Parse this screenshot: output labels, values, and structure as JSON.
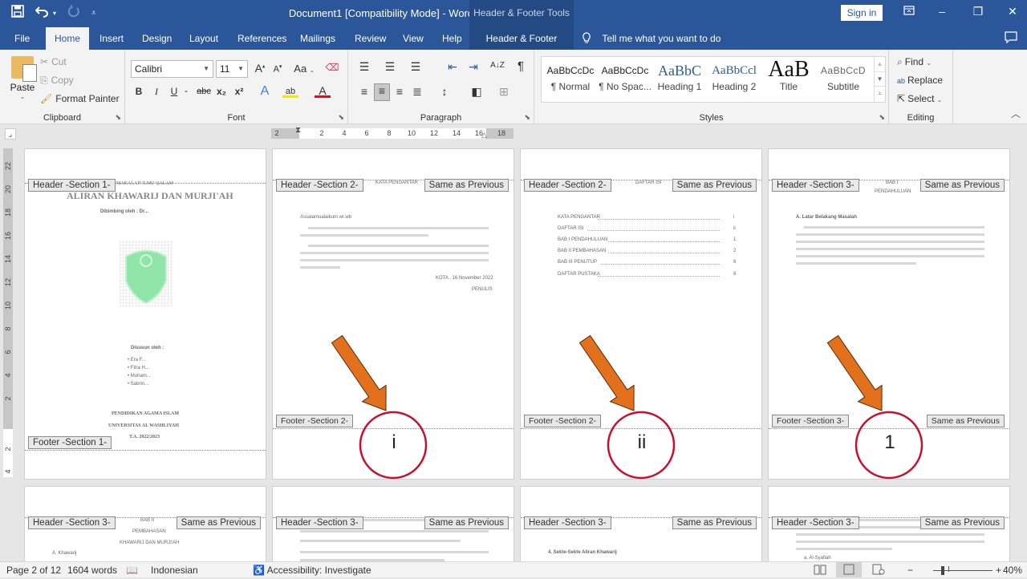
{
  "titlebar": {
    "title": "Document1 [Compatibility Mode]  -  Word",
    "context_tools": "Header & Footer Tools",
    "sign_in": "Sign in",
    "qat": {
      "save": "save-icon",
      "undo": "undo-icon",
      "redo": "redo-icon",
      "customize": "customize-qat-icon"
    },
    "window_controls": {
      "ribbon_display": "ribbon-display-options-icon",
      "minimize": "–",
      "restore": "❐",
      "close": "✕"
    }
  },
  "tabs": [
    {
      "label": "File"
    },
    {
      "label": "Home",
      "active": true
    },
    {
      "label": "Insert"
    },
    {
      "label": "Design"
    },
    {
      "label": "Layout"
    },
    {
      "label": "References"
    },
    {
      "label": "Mailings"
    },
    {
      "label": "Review"
    },
    {
      "label": "View"
    },
    {
      "label": "Help"
    },
    {
      "label": "Header & Footer",
      "contextual": true
    }
  ],
  "tell_me": "Tell me what you want to do",
  "ribbon": {
    "clipboard": {
      "label": "Clipboard",
      "paste": "Paste",
      "cut": "Cut",
      "copy": "Copy",
      "format_painter": "Format Painter"
    },
    "font": {
      "label": "Font",
      "font_name": "Calibri",
      "font_size": "11",
      "change_case": "Aa",
      "bold": "B",
      "italic": "I",
      "underline": "U",
      "strike": "abc",
      "subscript": "x₂",
      "superscript": "x²",
      "grow": "A",
      "shrink": "A"
    },
    "paragraph": {
      "label": "Paragraph",
      "sort": "A↓Z",
      "pilcrow": "¶"
    },
    "styles": {
      "label": "Styles",
      "items": [
        {
          "preview": "AaBbCcDc",
          "name": "¶ Normal"
        },
        {
          "preview": "AaBbCcDc",
          "name": "¶ No Spac..."
        },
        {
          "preview": "AaBbC",
          "name": "Heading 1"
        },
        {
          "preview": "AaBbCcl",
          "name": "Heading 2"
        },
        {
          "preview": "AaB",
          "name": "Title"
        },
        {
          "preview": "AaBbCcD",
          "name": "Subtitle"
        }
      ]
    },
    "editing": {
      "label": "Editing",
      "find": "Find",
      "replace": "Replace",
      "select": "Select"
    }
  },
  "ruler": {
    "horizontal": [
      "2",
      "2",
      "4",
      "6",
      "8",
      "10",
      "12",
      "14",
      "16",
      "18"
    ],
    "vertical": [
      "22",
      "20",
      "18",
      "16",
      "14",
      "12",
      "10",
      "8",
      "6",
      "4",
      "2",
      "2",
      "4"
    ]
  },
  "pages": [
    {
      "header_tag": "Header -Section 1-",
      "footer_tag": "Footer -Section 1-",
      "lines": [
        "MAKALAH ILMU QALAM",
        "ALIRAN KHAWARIJ DAN MURJI'AH",
        "Dibimbing oleh : Dr..."
      ],
      "authors_heading": "Disusun oleh :",
      "authors": [
        "Era F...",
        "Fitra H...",
        "Muham...",
        "Sabrin..."
      ],
      "footer_lines": [
        "PENDIDIKAN AGAMA ISLAM",
        "UNIVERSITAS AL WASHLIYAH",
        "T.A. 2022/2023"
      ]
    },
    {
      "header_tag": "Header -Section 2-",
      "same_as_previous": "Same as Previous",
      "footer_tag": "Footer -Section 2-",
      "heading": "KATA PENGANTAR",
      "greeting": "Assalamualaikum wr.wb",
      "place_date": "KOTA , 16 November 2022",
      "signature": "PENULIS",
      "page_number": "i"
    },
    {
      "header_tag": "Header -Section 2-",
      "same_as_previous": "Same as Previous",
      "footer_tag": "Footer -Section 2-",
      "heading": "DAFTAR ISI",
      "toc": [
        {
          "entry": "KATA PENGANTAR",
          "page": "i"
        },
        {
          "entry": "DAFTAR ISI",
          "page": "ii"
        },
        {
          "entry": "BAB I  PENDAHULUAN",
          "page": "1"
        },
        {
          "entry": "BAB II  PEMBAHASAN",
          "page": "2"
        },
        {
          "entry": "BAB III PENUTUP",
          "page": "6"
        },
        {
          "entry": "DAFTAR PUSTAKA",
          "page": "8"
        }
      ],
      "page_number": "ii"
    },
    {
      "header_tag": "Header -Section 3-",
      "same_as_previous": "Same as Previous",
      "footer_tag": "Footer -Section 3-",
      "footer_same_as_previous": "Same as Previous",
      "heading": "BAB I",
      "subheading": "PENDAHULUAN",
      "section": "A.  Latar Belakang Masalah",
      "page_number": "1"
    },
    {
      "header_tag": "Header -Section 3-",
      "same_as_previous": "Same as Previous",
      "heading": "BAB II",
      "subheading": "PEMBAHASAN",
      "subheading2": "KHAWARIJ DAN MURJI'AH",
      "section": "A.  Khawarij"
    },
    {
      "header_tag": "Header -Section 3-",
      "same_as_previous": "Same as Previous"
    },
    {
      "header_tag": "Header -Section 3-",
      "same_as_previous": "Same as Previous",
      "section": "4.   Sekte-Sekte Aliran Khawarij"
    },
    {
      "header_tag": "Header -Section 3-",
      "same_as_previous": "Same as Previous",
      "item": "a.    Al-Syafiah"
    }
  ],
  "annotation_colors": {
    "arrow": "#e2711d",
    "circle": "#c8102e"
  },
  "statusbar": {
    "page": "Page 2 of 12",
    "words": "1604 words",
    "language": "Indonesian",
    "accessibility": "Accessibility: Investigate",
    "zoom_percent": "40%",
    "zoom_level": 40
  }
}
